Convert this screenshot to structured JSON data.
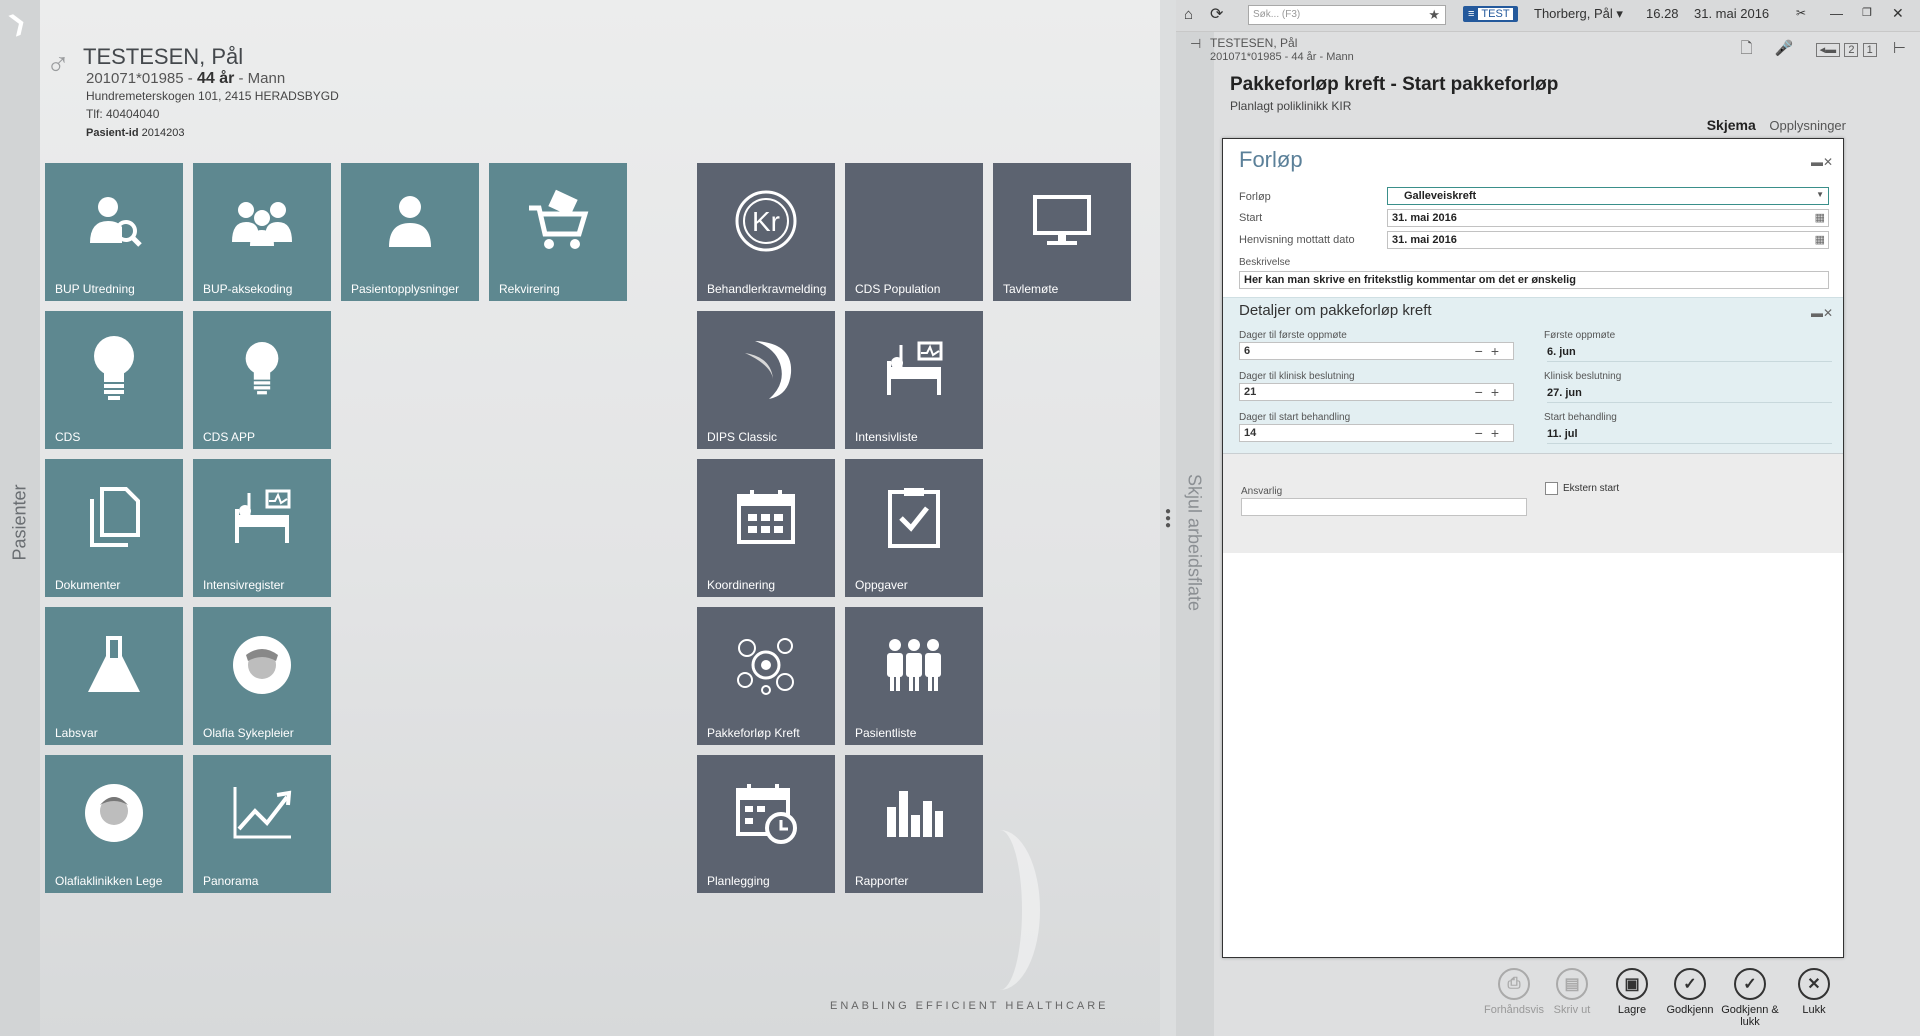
{
  "left_sidebar": {
    "label": "Pasienter"
  },
  "patient": {
    "gender_symbol": "♂",
    "name": "TESTESEN, Pål",
    "id": "201071*01985",
    "age": "44 år",
    "sex": "Mann",
    "address": "Hundremeterskogen 101, 2415 HERADSBYGD",
    "phone": "Tlf: 40404040",
    "patient_id_label": "Pasient-id",
    "patient_id": "2014203"
  },
  "tiles": {
    "bup_utredning": "BUP Utredning",
    "bup_aksekoding": "BUP-aksekoding",
    "pasientopplysninger": "Pasientopplysninger",
    "rekvirering": "Rekvirering",
    "cds": "CDS",
    "cds_app": "CDS APP",
    "dokumenter": "Dokumenter",
    "intensivregister": "Intensivregister",
    "labsvar": "Labsvar",
    "olafia_sykepleier": "Olafia Sykepleier",
    "olafiaklinikken_lege": "Olafiaklinikken Lege",
    "panorama": "Panorama",
    "behandlerkravmelding": "Behandlerkravmelding",
    "cds_population": "CDS Population",
    "tavlemote": "Tavlemøte",
    "dips_classic": "DIPS Classic",
    "intensivliste": "Intensivliste",
    "koordinering": "Koordinering",
    "oppgaver": "Oppgaver",
    "pakkeforlop_kreft": "Pakkeforløp Kreft",
    "pasientliste": "Pasientliste",
    "planlegging": "Planlegging",
    "rapporter": "Rapporter"
  },
  "tagline": "ENABLING EFFICIENT HEALTHCARE",
  "topbar": {
    "search_placeholder": "Søk... (F3)",
    "env_badge": "TEST",
    "user": "Thorberg, Pål ▾",
    "time": "16.28",
    "date": "31. mai 2016"
  },
  "worksheet": {
    "hide_label": "Skjul arbeidsflate",
    "patient_name": "TESTESEN, Pål",
    "patient_line": "201071*01985 - 44 år - Mann",
    "title": "Pakkeforløp kreft - Start pakkeforløp",
    "subtitle": "Planlagt poliklinikk KIR",
    "tab_active": "Skjema",
    "tab_other": "Opplysninger",
    "nav_counter1": "2",
    "nav_counter2": "1"
  },
  "form": {
    "section1_title": "Forløp",
    "forlop_label": "Forløp",
    "forlop_value": "Galleveiskreft",
    "start_label": "Start",
    "start_value": "31. mai 2016",
    "henvisning_label": "Henvisning mottatt dato",
    "henvisning_value": "31. mai 2016",
    "beskrivelse_label": "Beskrivelse",
    "beskrivelse_value": "Her kan man skrive en fritekstlig kommentar om det er ønskelig",
    "section2_title": "Detaljer om pakkeforløp kreft",
    "d1_label": "Dager til første oppmøte",
    "d1_value": "6",
    "r1_label": "Første oppmøte",
    "r1_value": "6. jun",
    "d2_label": "Dager til klinisk beslutning",
    "d2_value": "21",
    "r2_label": "Klinisk beslutning",
    "r2_value": "27. jun",
    "d3_label": "Dager til start behandling",
    "d3_value": "14",
    "r3_label": "Start behandling",
    "r3_value": "11. jul",
    "ansvarlig_label": "Ansvarlig",
    "ansvarlig_value": "",
    "ekstern_label": "Ekstern start"
  },
  "buttons": {
    "forhandsvis": "Forhåndsvis",
    "skriv_ut": "Skriv ut",
    "lagre": "Lagre",
    "godkjenn": "Godkjenn",
    "godkjenn_lukk": "Godkjenn & lukk",
    "lukk": "Lukk"
  },
  "colors": {
    "tile_teal": "#5e8890",
    "tile_dark": "#5c6370",
    "accent_blue": "#24599c"
  }
}
